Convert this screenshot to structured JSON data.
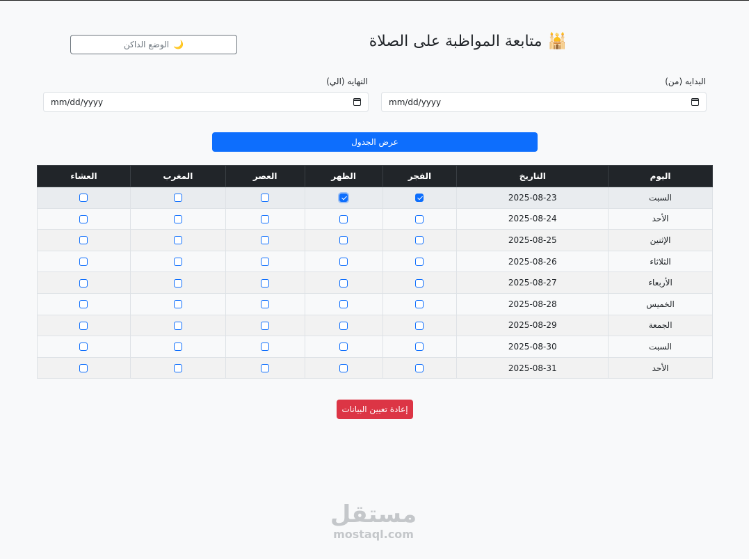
{
  "header": {
    "title": "متابعة المواظبة على الصلاة",
    "title_icon": "🕌",
    "dark_mode_label": "الوضع الداكن",
    "dark_mode_icon": "🌙"
  },
  "filters": {
    "from_label": "البدايه (من)",
    "to_label": "النهايه (الي)",
    "from_placeholder": "mm/dd/yyyy",
    "to_placeholder": "mm/dd/yyyy"
  },
  "show_button": "عرض الجدول",
  "reset_button": "إعادة تعيين البيانات",
  "table": {
    "headers": [
      "اليوم",
      "التاريخ",
      "الفجر",
      "الظهر",
      "العصر",
      "المغرب",
      "العشاء"
    ],
    "rows": [
      {
        "day": "السبت",
        "date": "2025-08-23",
        "checks": [
          true,
          true,
          false,
          false,
          false
        ]
      },
      {
        "day": "الأحد",
        "date": "2025-08-24",
        "checks": [
          false,
          false,
          false,
          false,
          false
        ]
      },
      {
        "day": "الإثنين",
        "date": "2025-08-25",
        "checks": [
          false,
          false,
          false,
          false,
          false
        ]
      },
      {
        "day": "الثلاثاء",
        "date": "2025-08-26",
        "checks": [
          false,
          false,
          false,
          false,
          false
        ]
      },
      {
        "day": "الأربعاء",
        "date": "2025-08-27",
        "checks": [
          false,
          false,
          false,
          false,
          false
        ]
      },
      {
        "day": "الخميس",
        "date": "2025-08-28",
        "checks": [
          false,
          false,
          false,
          false,
          false
        ]
      },
      {
        "day": "الجمعة",
        "date": "2025-08-29",
        "checks": [
          false,
          false,
          false,
          false,
          false
        ]
      },
      {
        "day": "السبت",
        "date": "2025-08-30",
        "checks": [
          false,
          false,
          false,
          false,
          false
        ]
      },
      {
        "day": "الأحد",
        "date": "2025-08-31",
        "checks": [
          false,
          false,
          false,
          false,
          false
        ]
      }
    ]
  },
  "watermark": {
    "arabic": "مستقل",
    "latin": "mostaql.com"
  },
  "colors": {
    "primary": "#0d6efd",
    "danger": "#dc3545",
    "header_bg": "#212529"
  }
}
